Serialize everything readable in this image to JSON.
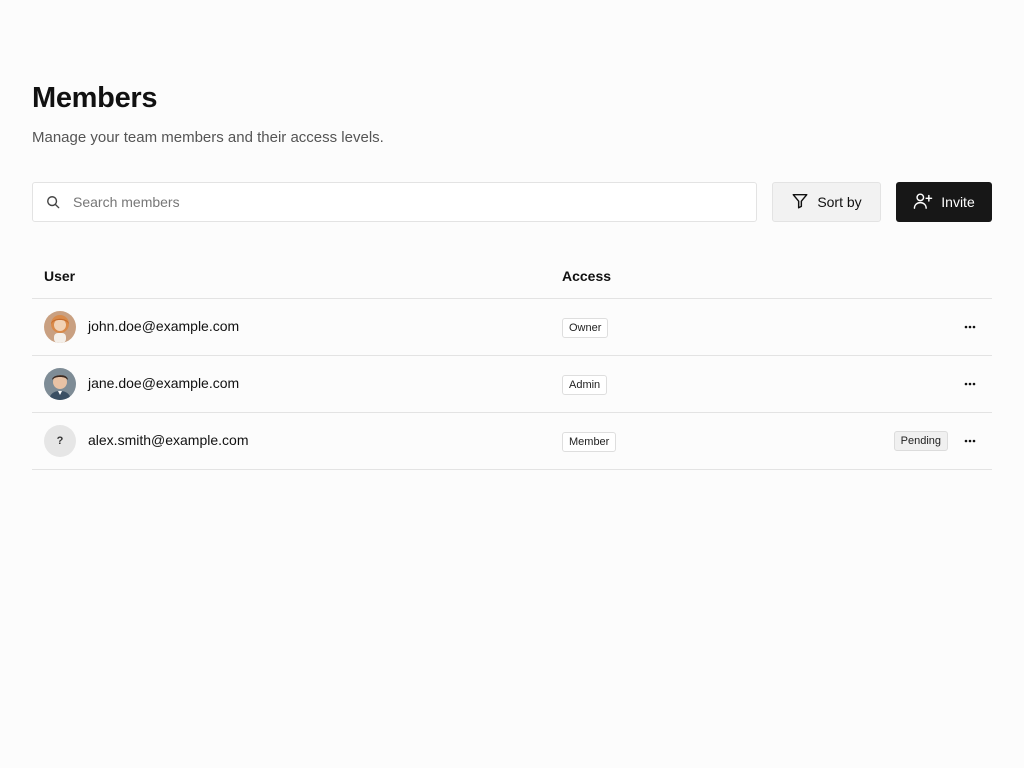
{
  "header": {
    "title": "Members",
    "subtitle": "Manage your team members and their access levels."
  },
  "toolbar": {
    "search_placeholder": "Search members",
    "search_value": "",
    "search_icon": "search-icon",
    "sort_label": "Sort by",
    "sort_icon": "filter-icon",
    "invite_label": "Invite",
    "invite_icon": "user-plus-icon"
  },
  "table": {
    "columns": [
      "User",
      "Access"
    ],
    "rows": [
      {
        "email": "john.doe@example.com",
        "role": "Owner",
        "status": "",
        "avatar": "photo"
      },
      {
        "email": "jane.doe@example.com",
        "role": "Admin",
        "status": "",
        "avatar": "photo"
      },
      {
        "email": "alex.smith@example.com",
        "role": "Member",
        "status": "Pending",
        "avatar": "?"
      }
    ]
  },
  "colors": {
    "background": "#fcfcfc",
    "primary_button": "#171717",
    "border": "#e3e3e3"
  }
}
